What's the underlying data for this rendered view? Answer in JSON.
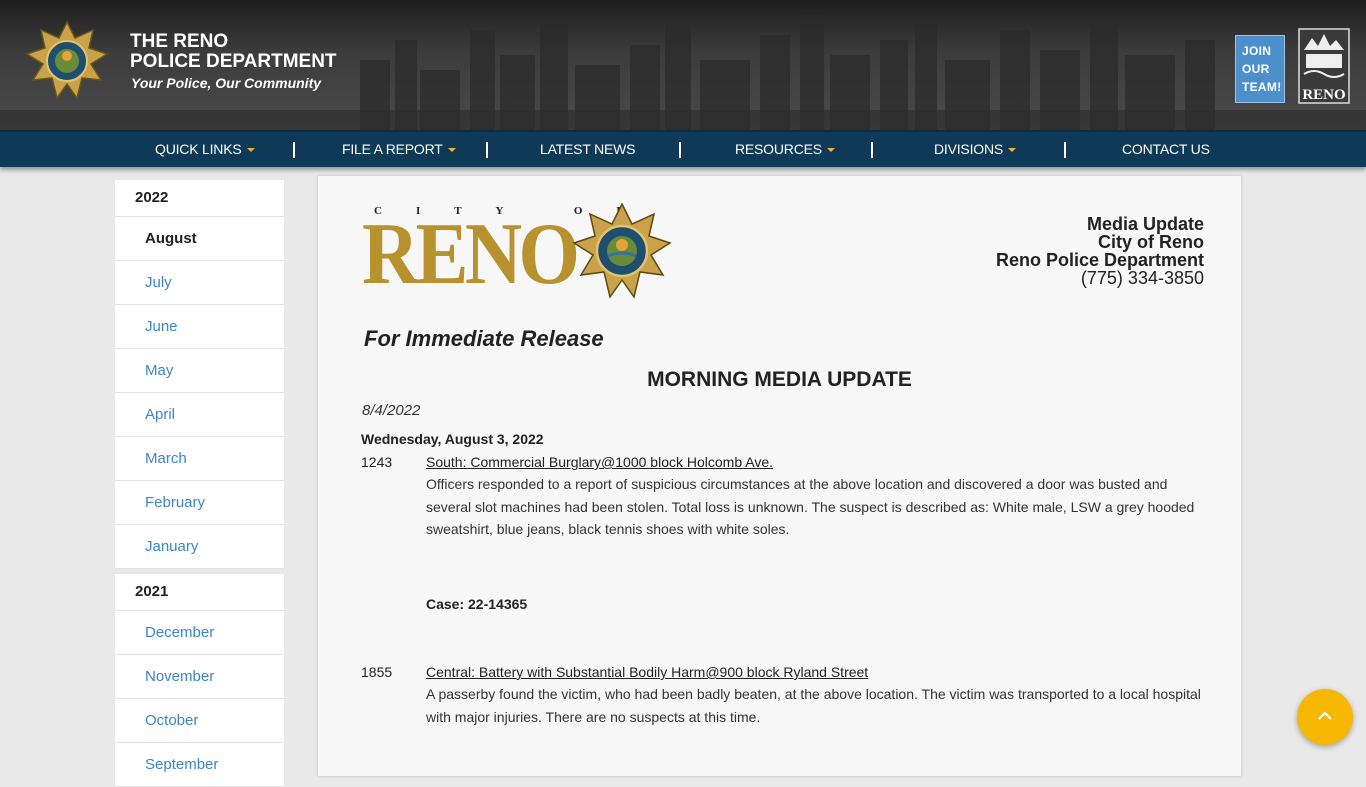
{
  "header": {
    "title_line1": "THE RENO",
    "title_line2": "POLICE DEPARTMENT",
    "tagline": "Your Police, Our Community",
    "join_line1": "JOIN",
    "join_line2": "OUR",
    "join_line3": "TEAM!",
    "city_logo_text": "RENO"
  },
  "nav": {
    "items": [
      {
        "label": "QUICK LINKS",
        "dropdown": true
      },
      {
        "label": "FILE A REPORT",
        "dropdown": true
      },
      {
        "label": "LATEST NEWS",
        "dropdown": false
      },
      {
        "label": "RESOURCES",
        "dropdown": true
      },
      {
        "label": "DIVISIONS",
        "dropdown": true
      },
      {
        "label": "CONTACT US",
        "dropdown": false
      }
    ]
  },
  "sidebar": {
    "years": [
      {
        "year": "2022",
        "months": [
          "August",
          "July",
          "June",
          "May",
          "April",
          "March",
          "February",
          "January"
        ],
        "active": "August"
      },
      {
        "year": "2021",
        "months": [
          "December",
          "November",
          "October",
          "September"
        ]
      }
    ]
  },
  "article": {
    "city_of": "CITY OF",
    "city_name": "RENO",
    "media_line1": "Media Update",
    "media_line2": "City of Reno",
    "media_line3": "Reno Police Department",
    "media_phone": "(775) 334-3850",
    "release": "For Immediate Release",
    "heading": "MORNING MEDIA UPDATE",
    "date": "8/4/2022",
    "day_heading": "Wednesday, August 3, 2022",
    "incidents": [
      {
        "time": "1243",
        "title": "South: Commercial Burglary@1000 block Holcomb Ave.",
        "body": "Officers responded to a report of suspicious circumstances at the above location and discovered a door was busted and several slot machines had been stolen. Total loss is unknown. The suspect is described as: White male, LSW a grey hooded sweatshirt, blue jeans, black tennis shoes with white soles.",
        "case": "Case: 22-14365"
      },
      {
        "time": "1855",
        "title": "Central: Battery with Substantial Bodily Harm@900 block Ryland Street",
        "body": "A passerby found the victim, who had been badly beaten, at the above location. The victim was transported to a local hospital with major injuries. There are no suspects at this time."
      }
    ]
  },
  "colors": {
    "nav_bg": "#0e3a57",
    "caret": "#e8b62a",
    "link": "#3b86c6",
    "reno_gold": "#b8922e",
    "scroll_button": "#f5b700",
    "join_button": "#4b8fcb"
  },
  "icons": {
    "badge": "police-star-badge-icon",
    "scroll": "chevron-up-icon"
  }
}
